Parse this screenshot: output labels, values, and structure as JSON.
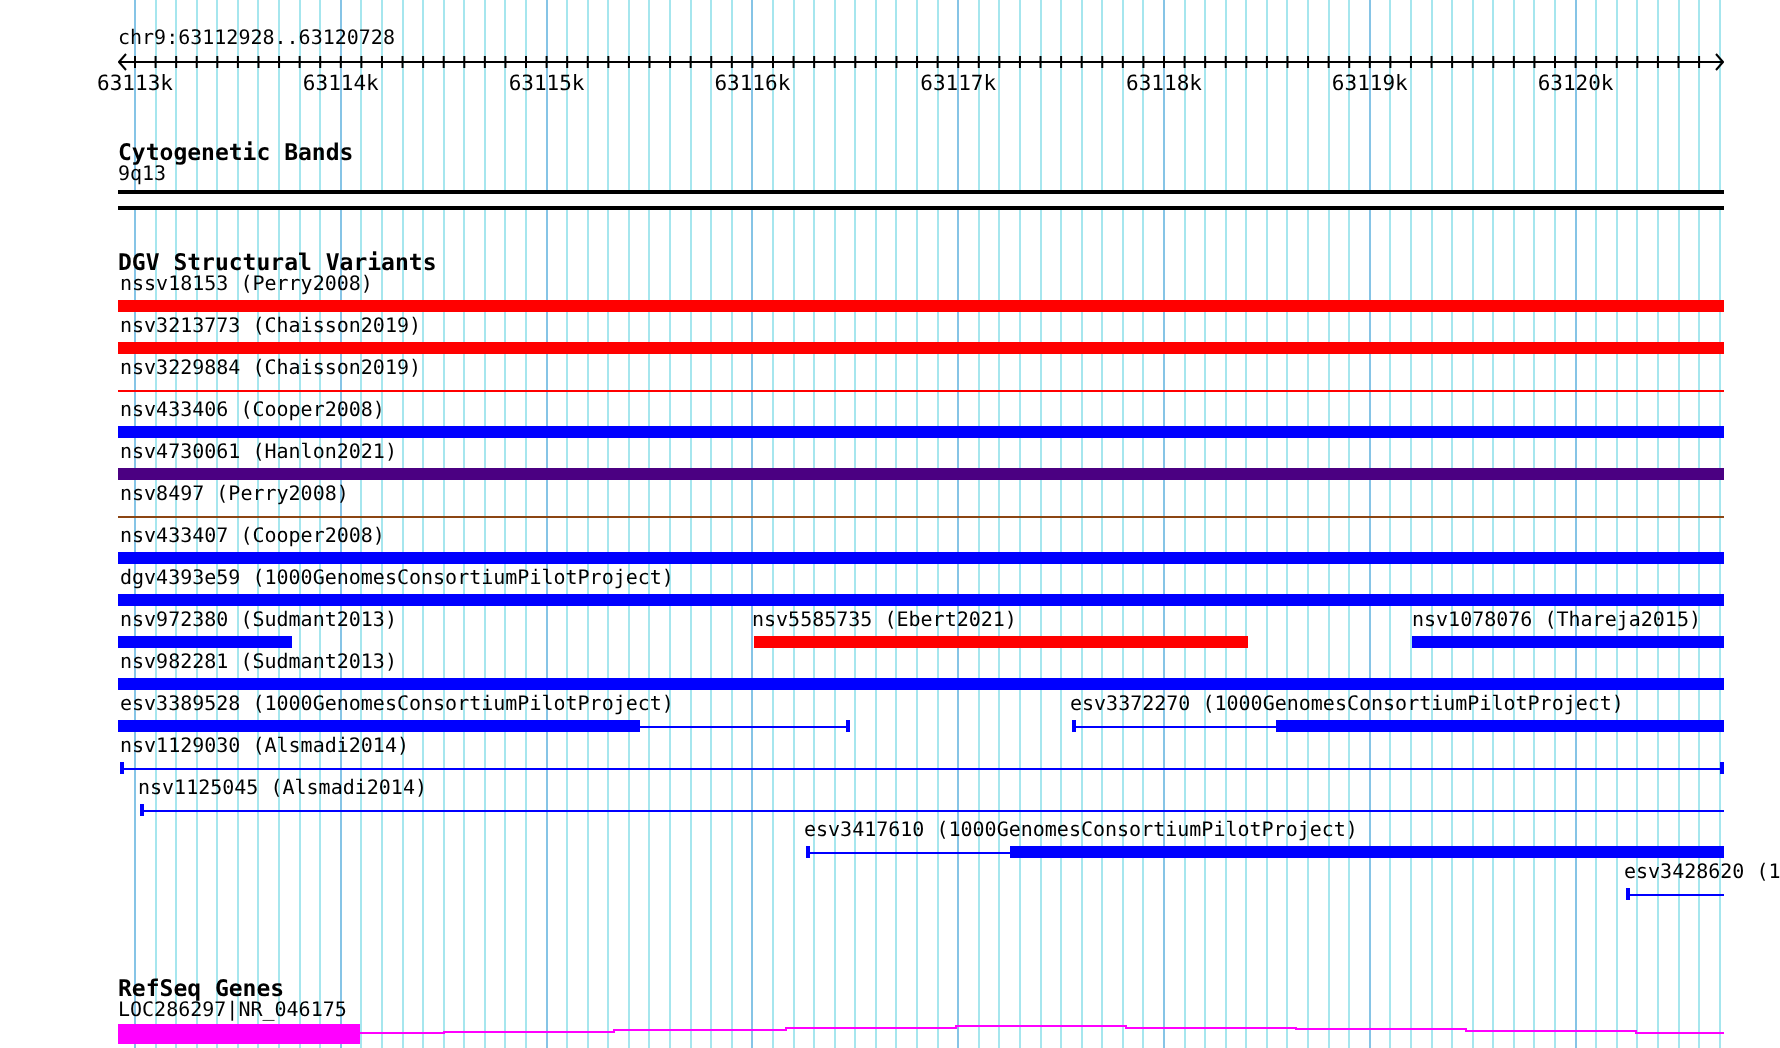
{
  "ruler": {
    "location": "chr9:63112928..63120728",
    "ticks": [
      "63113k",
      "63114k",
      "63115k",
      "63116k",
      "63117k",
      "63118k",
      "63119k",
      "63120k"
    ]
  },
  "cytoband_track": {
    "title": "Cytogenetic Bands",
    "bands": [
      {
        "label": "9q13"
      }
    ]
  },
  "variant_track": {
    "title": "DGV Structural Variants",
    "lanes": [
      {
        "features": [
          {
            "label": "nssv18153 (Perry2008)",
            "color": "#ff0000",
            "kind": "thick"
          }
        ]
      },
      {
        "features": [
          {
            "label": "nsv3213773 (Chaisson2019)",
            "color": "#ff0000",
            "kind": "thick"
          }
        ]
      },
      {
        "features": [
          {
            "label": "nsv3229884 (Chaisson2019)",
            "color": "#ff0000",
            "kind": "line"
          }
        ]
      },
      {
        "features": [
          {
            "label": "nsv433406 (Cooper2008)",
            "color": "#0000ff",
            "kind": "thick"
          }
        ]
      },
      {
        "features": [
          {
            "label": "nsv4730061 (Hanlon2021)",
            "color": "#4b0082",
            "kind": "thick"
          }
        ]
      },
      {
        "features": [
          {
            "label": "nsv8497 (Perry2008)",
            "color": "#8b4513",
            "kind": "line"
          }
        ]
      },
      {
        "features": [
          {
            "label": "nsv433407 (Cooper2008)",
            "color": "#0000ff",
            "kind": "thick"
          }
        ]
      },
      {
        "features": [
          {
            "label": "dgv4393e59 (1000GenomesConsortiumPilotProject)",
            "color": "#0000ff",
            "kind": "thick"
          }
        ]
      },
      {
        "features": [
          {
            "label": "nsv972380 (Sudmant2013)",
            "color": "#0000ff",
            "kind": "thick"
          },
          {
            "label": "nsv5585735 (Ebert2021)",
            "color": "#ff0000",
            "kind": "thick"
          },
          {
            "label": "nsv1078076 (Thareja2015)",
            "color": "#0000ff",
            "kind": "thick"
          }
        ]
      },
      {
        "features": [
          {
            "label": "nsv982281 (Sudmant2013)",
            "color": "#0000ff",
            "kind": "thick"
          }
        ]
      },
      {
        "features": [
          {
            "label": "esv3389528 (1000GenomesConsortiumPilotProject)",
            "color": "#0000ff",
            "kind": "mixed"
          },
          {
            "label": "esv3372270 (1000GenomesConsortiumPilotProject)",
            "color": "#0000ff",
            "kind": "mixed"
          }
        ]
      },
      {
        "features": [
          {
            "label": "nsv1129030 (Alsmadi2014)",
            "color": "#0000ff",
            "kind": "span"
          }
        ]
      },
      {
        "features": [
          {
            "label": "nsv1125045 (Alsmadi2014)",
            "color": "#0000ff",
            "kind": "span"
          }
        ]
      },
      {
        "features": [
          {
            "label": "esv3417610 (1000GenomesConsortiumPilotProject)",
            "color": "#0000ff",
            "kind": "mixed"
          }
        ]
      },
      {
        "features": [
          {
            "label": "esv3428620 (1",
            "color": "#0000ff",
            "kind": "span"
          }
        ]
      }
    ]
  },
  "gene_track": {
    "title": "RefSeq Genes",
    "genes": [
      {
        "label": "LOC286297|NR_046175"
      }
    ]
  }
}
